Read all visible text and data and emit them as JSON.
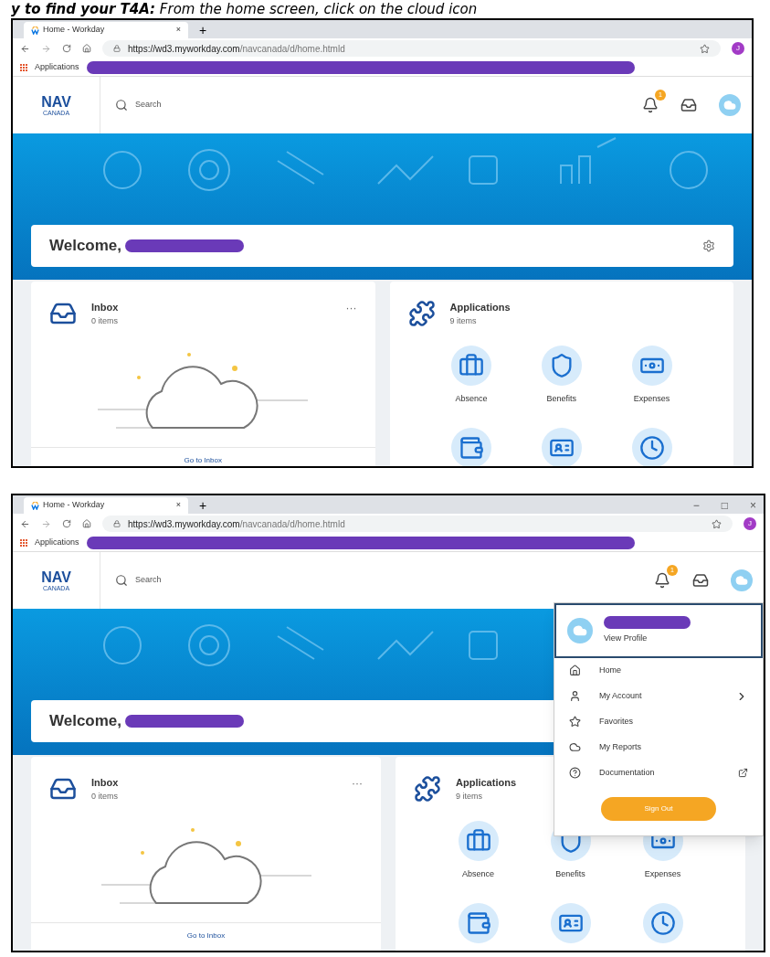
{
  "heading": "**y to find your T4A:** From the home screen, click on the cloud icon",
  "screenshots": [
    {
      "tab_title": "Home - Workday",
      "tab_close": "×",
      "new_tab": "+",
      "url_host": "https://wd3.myworkday.com",
      "url_path": "/navcanada/d/home.htmld",
      "avatar_letter": "J",
      "bookmark": "Applications",
      "logo_top": "NAV",
      "logo_bottom": "CANADA",
      "search_placeholder": "Search",
      "notification_count": "1",
      "welcome": "Welcome,",
      "inbox": {
        "title": "Inbox",
        "count": "0 items",
        "link": "Go to Inbox",
        "more": "···"
      },
      "applications": {
        "title": "Applications",
        "count": "9 items",
        "tiles": [
          "Absence",
          "Benefits",
          "Expenses"
        ]
      }
    },
    {
      "tab_title": "Home - Workday",
      "tab_close": "×",
      "new_tab": "+",
      "window_controls": [
        "−",
        "□",
        "×"
      ],
      "url_host": "https://wd3.myworkday.com",
      "url_path": "/navcanada/d/home.htmld",
      "avatar_letter": "J",
      "bookmark": "Applications",
      "logo_top": "NAV",
      "logo_bottom": "CANADA",
      "search_placeholder": "Search",
      "notification_count": "1",
      "welcome": "Welcome,",
      "inbox": {
        "title": "Inbox",
        "count": "0 items",
        "link": "Go to Inbox",
        "more": "···"
      },
      "applications": {
        "title": "Applications",
        "count": "9 items",
        "tiles": [
          "Absence",
          "Benefits",
          "Expenses"
        ]
      },
      "profile_menu": {
        "view_profile": "View Profile",
        "items": [
          {
            "label": "Home",
            "submenu": false,
            "external_link": false
          },
          {
            "label": "My Account",
            "submenu": true,
            "external_link": false
          },
          {
            "label": "Favorites",
            "submenu": false,
            "external_link": false
          },
          {
            "label": "My Reports",
            "submenu": false,
            "external_link": false
          },
          {
            "label": "Documentation",
            "submenu": false,
            "external_link": true
          }
        ],
        "sign_out": "Sign Out"
      }
    }
  ]
}
